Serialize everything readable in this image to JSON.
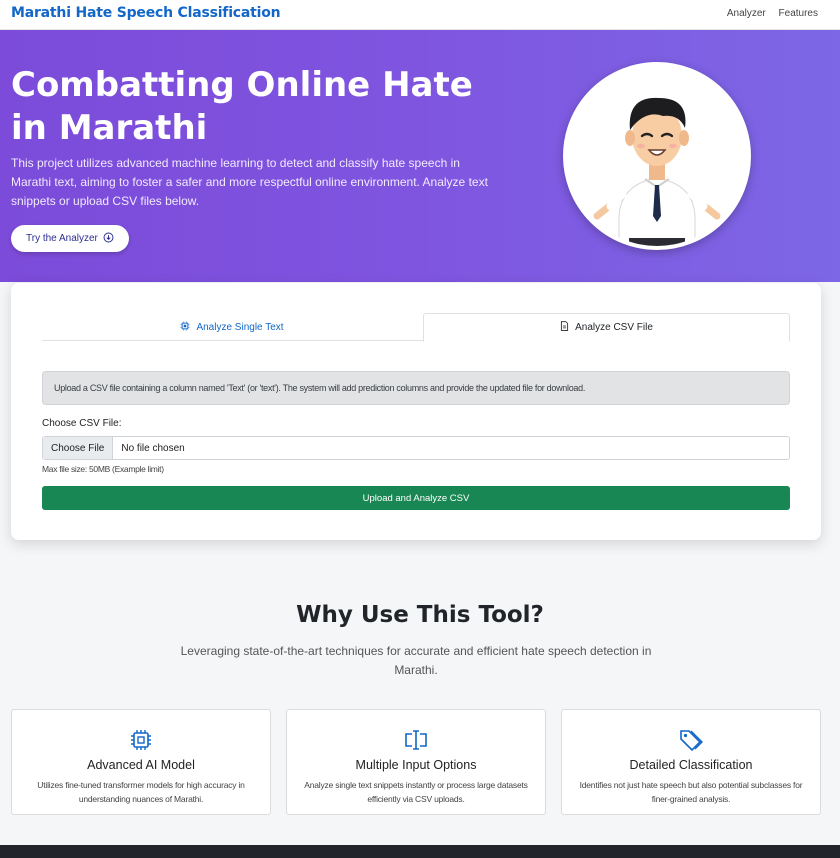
{
  "nav": {
    "brand": "Marathi Hate Speech Classification",
    "links": [
      "Analyzer",
      "Features"
    ]
  },
  "hero": {
    "title": "Combatting Online Hate in Marathi",
    "description": "This project utilizes advanced machine learning to detect and classify hate speech in Marathi text, aiming to foster a safer and more respectful online environment. Analyze text snippets or upload CSV files below.",
    "cta_label": "Try the Analyzer",
    "cta_icon": "arrow-down-circle-icon"
  },
  "analyzer": {
    "tabs": [
      {
        "label": "Analyze Single Text",
        "icon": "cpu-icon",
        "active": false
      },
      {
        "label": "Analyze CSV File",
        "icon": "file-icon",
        "active": true
      }
    ],
    "info": "Upload a CSV file containing a column named 'Text' (or 'text'). The system will add prediction columns and provide the updated file for download.",
    "file_label": "Choose CSV File:",
    "file_button": "Choose File",
    "file_status": "No file chosen",
    "file_hint": "Max file size: 50MB (Example limit)",
    "submit_label": "Upload and Analyze CSV"
  },
  "why": {
    "title": "Why Use This Tool?",
    "description": "Leveraging state-of-the-art techniques for accurate and efficient hate speech detection in Marathi.",
    "features": [
      {
        "icon": "chip-icon",
        "title": "Advanced AI Model",
        "description": "Utilizes fine-tuned transformer models for high accuracy in understanding nuances of Marathi."
      },
      {
        "icon": "text-cursor-icon",
        "title": "Multiple Input Options",
        "description": "Analyze single text snippets instantly or process large datasets efficiently via CSV uploads."
      },
      {
        "icon": "tags-icon",
        "title": "Detailed Classification",
        "description": "Identifies not just hate speech but also potential subclasses for finer-grained analysis."
      }
    ]
  },
  "colors": {
    "brand": "#1267c8",
    "hero_gradient_start": "#7c4bd9",
    "hero_gradient_end": "#7d67e6",
    "upload_button": "#198754",
    "footer": "#22252b"
  }
}
